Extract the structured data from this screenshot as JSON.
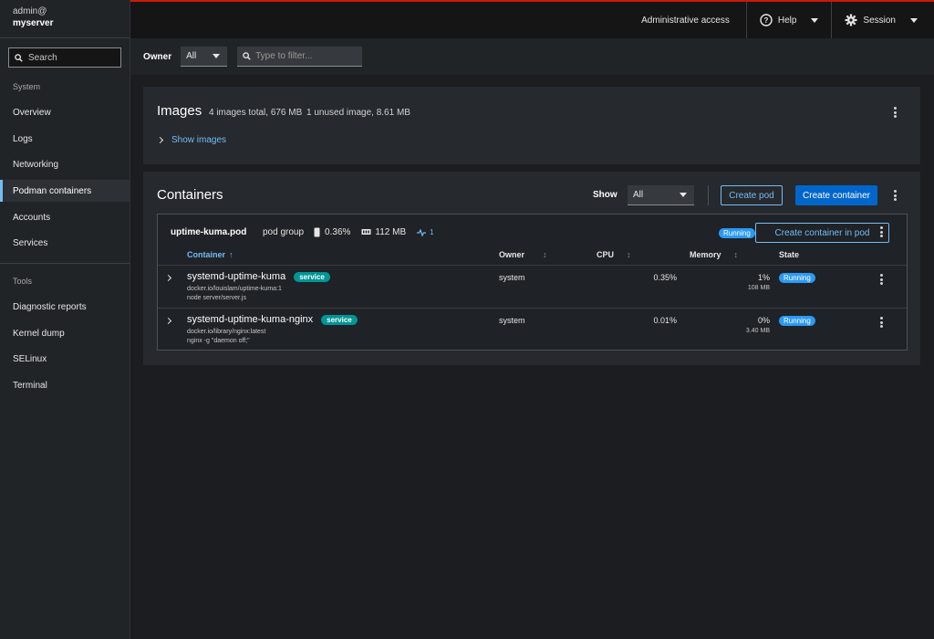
{
  "host": {
    "user": "admin@",
    "server": "myserver"
  },
  "sidebar": {
    "search_label": "Search",
    "system_label": "System",
    "tools_label": "Tools",
    "items": [
      {
        "label": "Overview"
      },
      {
        "label": "Logs"
      },
      {
        "label": "Networking"
      },
      {
        "label": "Podman containers",
        "active": true
      },
      {
        "label": "Accounts"
      },
      {
        "label": "Services"
      }
    ],
    "tools": [
      {
        "label": "Diagnostic reports"
      },
      {
        "label": "Kernel dump"
      },
      {
        "label": "SELinux"
      },
      {
        "label": "Terminal"
      }
    ]
  },
  "header": {
    "admin_access": "Administrative access",
    "help": "Help",
    "session": "Session",
    "accent_color": "#c9190b"
  },
  "filter": {
    "owner_label": "Owner",
    "owner_value": "All",
    "filter_placeholder": "Type to filter..."
  },
  "images": {
    "title": "Images",
    "total": "4 images total, 676 MB",
    "unused": "1 unused image, 8.61 MB",
    "show_link": "Show images"
  },
  "containers": {
    "title": "Containers",
    "show_label": "Show",
    "show_value": "All",
    "create_pod": "Create pod",
    "create_container": "Create container",
    "pod": {
      "name": "uptime-kuma.pod",
      "group_label": "pod group",
      "cpu": "0.36%",
      "memory": "112 MB",
      "net_count": "1",
      "state": "Running",
      "create_in_pod": "Create container in pod"
    },
    "columns": {
      "container": "Container",
      "owner": "Owner",
      "cpu": "CPU",
      "memory": "Memory",
      "state": "State"
    },
    "rows": [
      {
        "name": "systemd-uptime-kuma",
        "badge": "service",
        "image": "docker.io/louislam/uptime-kuma:1",
        "command": "node server/server.js",
        "owner": "system",
        "cpu": "0.35%",
        "memory": "1%",
        "memory_abs": "108 MB",
        "state": "Running"
      },
      {
        "name": "systemd-uptime-kuma-nginx",
        "badge": "service",
        "image": "docker.io/library/nginx:latest",
        "command": "nginx -g \"daemon off;\"",
        "owner": "system",
        "cpu": "0.01%",
        "memory": "0%",
        "memory_abs": "3.40 MB",
        "state": "Running"
      }
    ]
  }
}
